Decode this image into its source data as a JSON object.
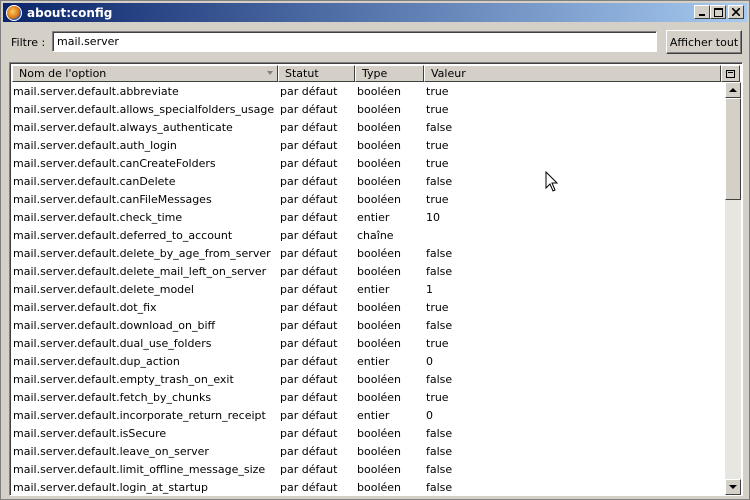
{
  "window": {
    "title": "about:config",
    "buttons": [
      "minimize",
      "maximize",
      "close"
    ]
  },
  "filter": {
    "label": "Filtre :",
    "value": "mail.server",
    "show_all_label": "Afficher tout"
  },
  "table": {
    "columns": {
      "name": "Nom de l'option",
      "status": "Statut",
      "type": "Type",
      "value": "Valeur"
    },
    "rows": [
      {
        "name": "mail.server.default.abbreviate",
        "status": "par défaut",
        "type": "booléen",
        "value": "true"
      },
      {
        "name": "mail.server.default.allows_specialfolders_usage",
        "status": "par défaut",
        "type": "booléen",
        "value": "true"
      },
      {
        "name": "mail.server.default.always_authenticate",
        "status": "par défaut",
        "type": "booléen",
        "value": "false"
      },
      {
        "name": "mail.server.default.auth_login",
        "status": "par défaut",
        "type": "booléen",
        "value": "true"
      },
      {
        "name": "mail.server.default.canCreateFolders",
        "status": "par défaut",
        "type": "booléen",
        "value": "true"
      },
      {
        "name": "mail.server.default.canDelete",
        "status": "par défaut",
        "type": "booléen",
        "value": "false"
      },
      {
        "name": "mail.server.default.canFileMessages",
        "status": "par défaut",
        "type": "booléen",
        "value": "true"
      },
      {
        "name": "mail.server.default.check_time",
        "status": "par défaut",
        "type": "entier",
        "value": "10"
      },
      {
        "name": "mail.server.default.deferred_to_account",
        "status": "par défaut",
        "type": "chaîne",
        "value": ""
      },
      {
        "name": "mail.server.default.delete_by_age_from_server",
        "status": "par défaut",
        "type": "booléen",
        "value": "false"
      },
      {
        "name": "mail.server.default.delete_mail_left_on_server",
        "status": "par défaut",
        "type": "booléen",
        "value": "false"
      },
      {
        "name": "mail.server.default.delete_model",
        "status": "par défaut",
        "type": "entier",
        "value": "1"
      },
      {
        "name": "mail.server.default.dot_fix",
        "status": "par défaut",
        "type": "booléen",
        "value": "true"
      },
      {
        "name": "mail.server.default.download_on_biff",
        "status": "par défaut",
        "type": "booléen",
        "value": "false"
      },
      {
        "name": "mail.server.default.dual_use_folders",
        "status": "par défaut",
        "type": "booléen",
        "value": "true"
      },
      {
        "name": "mail.server.default.dup_action",
        "status": "par défaut",
        "type": "entier",
        "value": "0"
      },
      {
        "name": "mail.server.default.empty_trash_on_exit",
        "status": "par défaut",
        "type": "booléen",
        "value": "false"
      },
      {
        "name": "mail.server.default.fetch_by_chunks",
        "status": "par défaut",
        "type": "booléen",
        "value": "true"
      },
      {
        "name": "mail.server.default.incorporate_return_receipt",
        "status": "par défaut",
        "type": "entier",
        "value": "0"
      },
      {
        "name": "mail.server.default.isSecure",
        "status": "par défaut",
        "type": "booléen",
        "value": "false"
      },
      {
        "name": "mail.server.default.leave_on_server",
        "status": "par défaut",
        "type": "booléen",
        "value": "false"
      },
      {
        "name": "mail.server.default.limit_offline_message_size",
        "status": "par défaut",
        "type": "booléen",
        "value": "false"
      },
      {
        "name": "mail.server.default.login_at_startup",
        "status": "par défaut",
        "type": "booléen",
        "value": "false"
      }
    ]
  },
  "colors": {
    "titlebar_start": "#0a246a",
    "titlebar_end": "#a6caf0",
    "window_bg": "#d4d0c8"
  }
}
